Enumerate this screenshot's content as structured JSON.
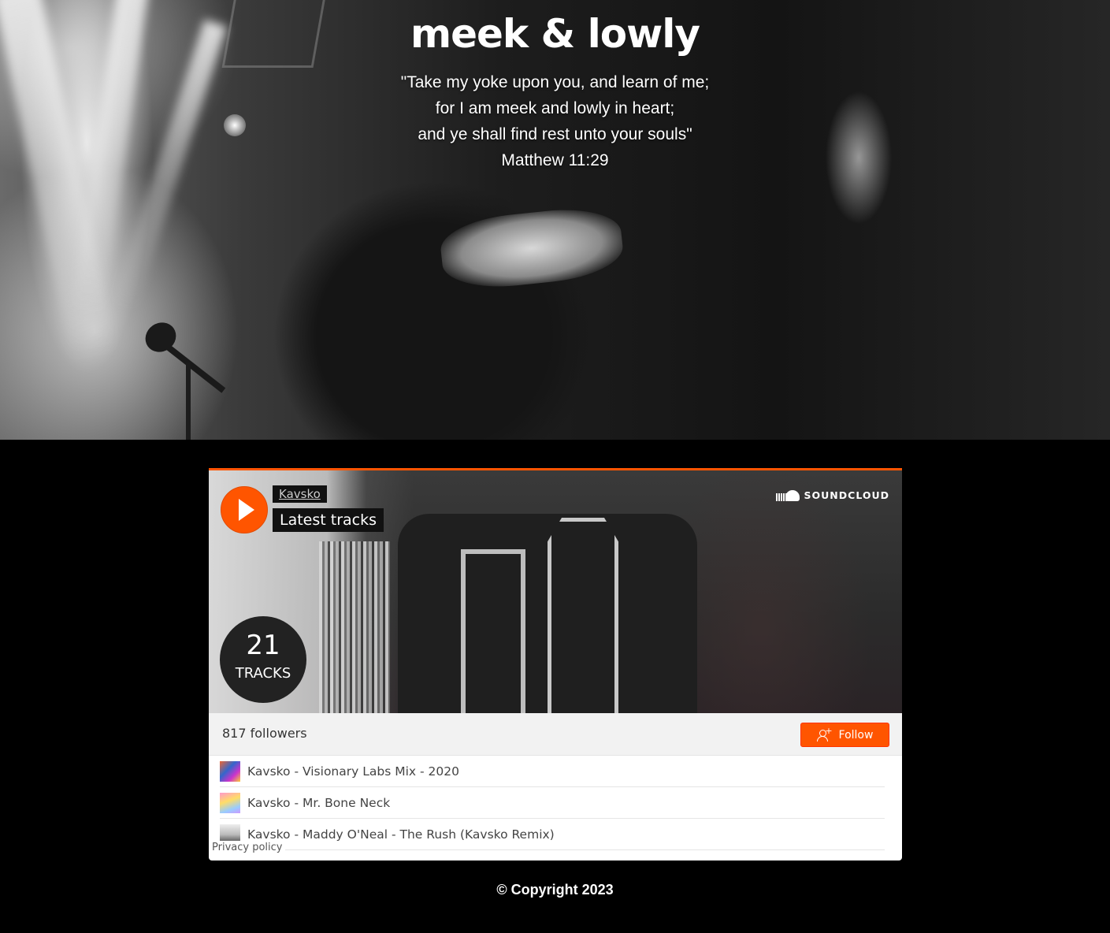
{
  "hero": {
    "brand": "meek & lowly",
    "verse_lines": [
      "\"Take my yoke upon you, and learn of me;",
      "for I am meek and lowly in heart;",
      "and ye shall find rest unto your souls\"",
      "Matthew 11:29"
    ]
  },
  "widget": {
    "accent_color": "#ff5500",
    "user": "Kavsko",
    "set_title": "Latest tracks",
    "brand_logo": "SOUNDCLOUD",
    "track_count": "21",
    "track_count_label": "TRACKS",
    "followers": "817 followers",
    "follow_label": "Follow",
    "tracks": [
      {
        "title": "Kavsko - Visionary Labs Mix - 2020"
      },
      {
        "title": "Kavsko - Mr. Bone Neck"
      },
      {
        "title": "Kavsko - Maddy O'Neal - The Rush (Kavsko Remix)"
      }
    ],
    "privacy_label": "Privacy policy"
  },
  "footer": {
    "copyright": "© Copyright 2023"
  }
}
